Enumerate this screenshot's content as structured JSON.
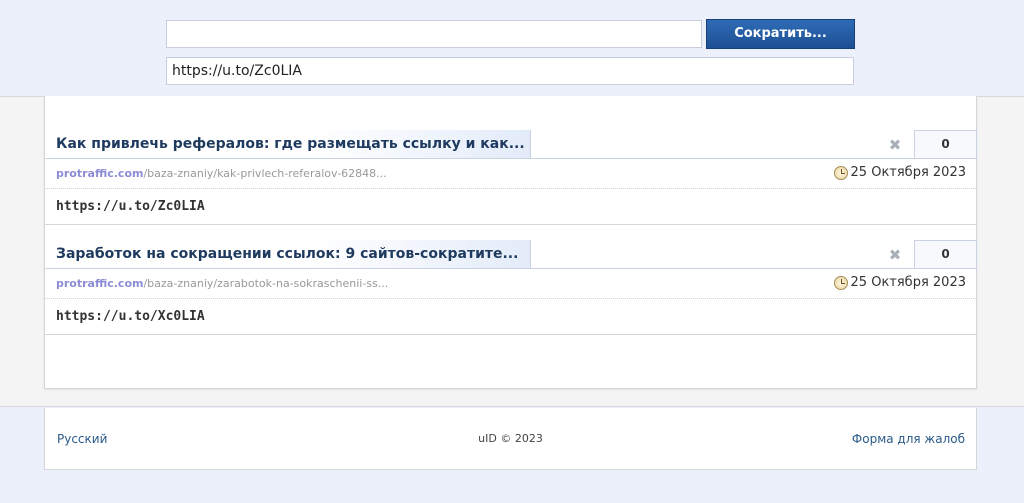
{
  "shortener": {
    "input_value": "",
    "button_label": "Сократить...",
    "result_value": "https://u.to/Zc0LIA"
  },
  "entries": [
    {
      "title": "Как привлечь рефералов: где размещать ссылку и как...",
      "count": "0",
      "source_domain": "protraffic.com",
      "source_path": "/baza-znaniy/kak-privlech-referalov-62848...",
      "date": "25 Октября 2023",
      "short_url": "https://u.to/Zc0LIA"
    },
    {
      "title": "Заработок на сокращении ссылок: 9 сайтов-сократите...",
      "count": "0",
      "source_domain": "protraffic.com",
      "source_path": "/baza-znaniy/zarabotok-na-sokraschenii-ss...",
      "date": "25 Октября 2023",
      "short_url": "https://u.to/Xc0LIA"
    }
  ],
  "icons": {
    "remove": "close-icon",
    "date": "clock-icon"
  },
  "footer": {
    "language": "Русский",
    "copyright": "uID © 2023",
    "complaint_link": "Форма для жалоб"
  },
  "colors": {
    "button": "#1d4f93",
    "title_text": "#1e3a5f",
    "source_domain": "#8c8cd6",
    "page_background": "#ecf0fb"
  }
}
